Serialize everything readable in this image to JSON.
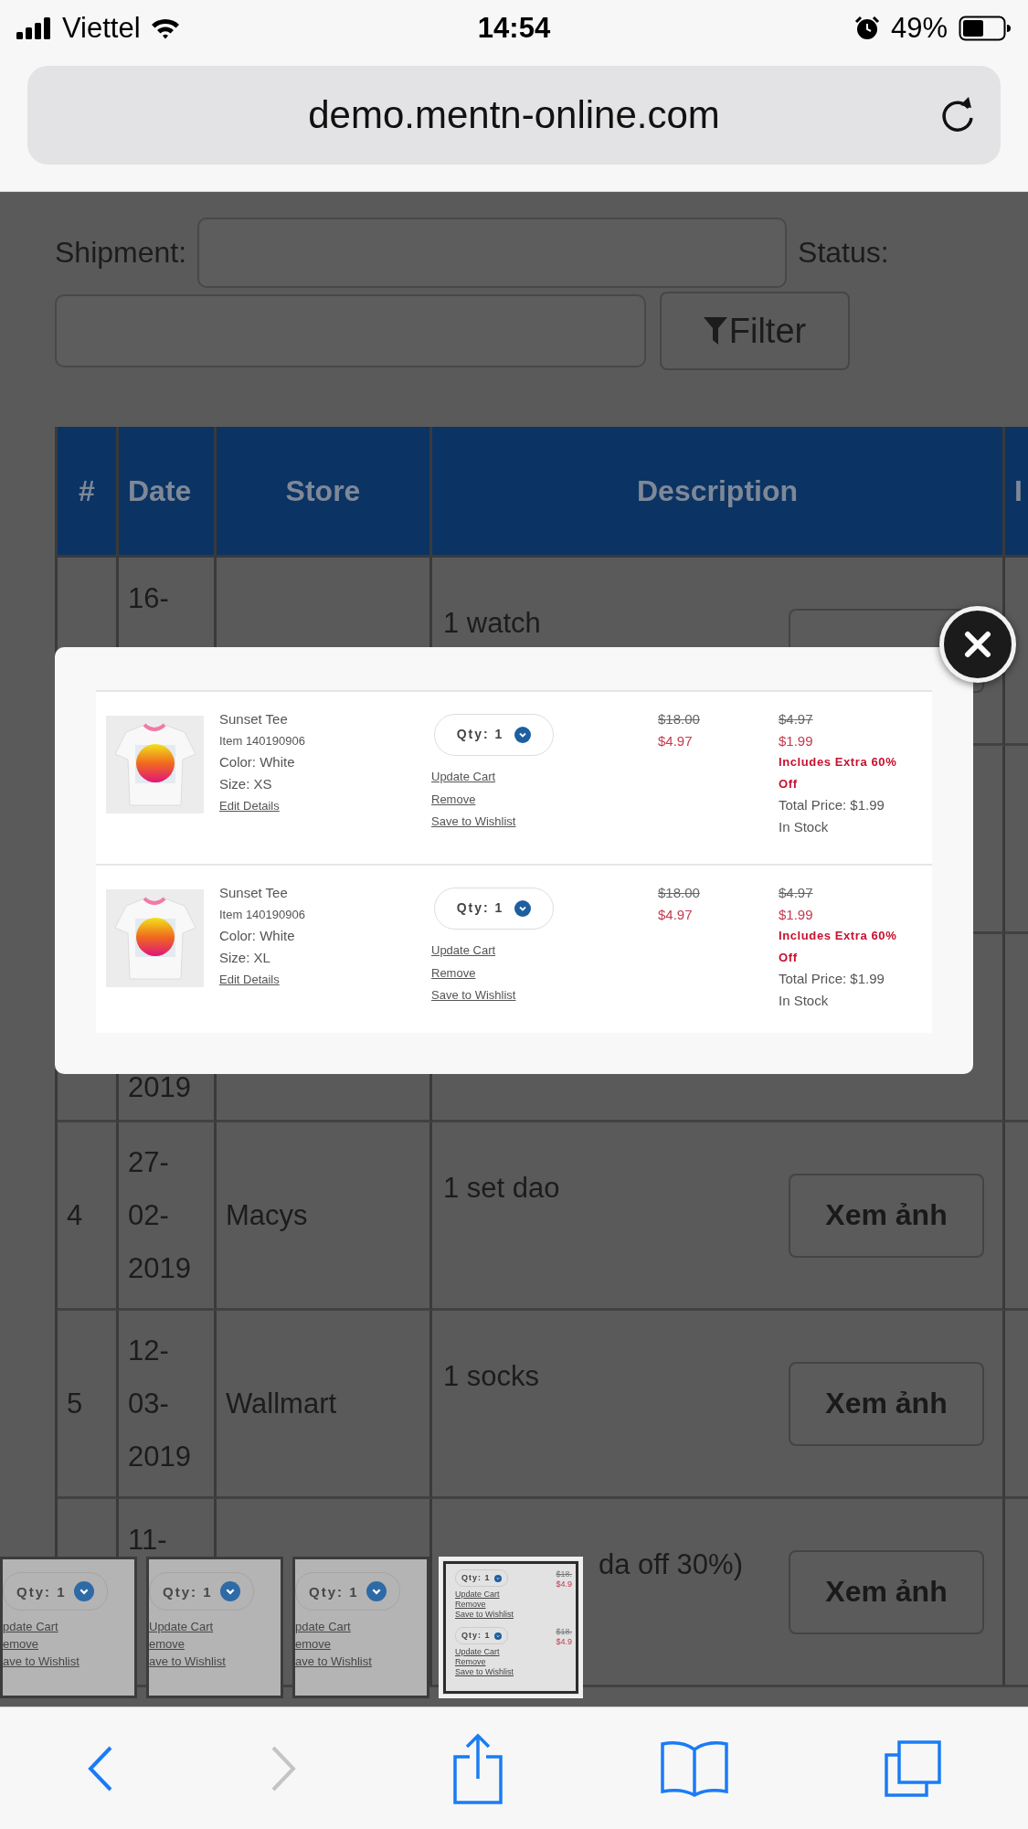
{
  "status_bar": {
    "carrier": "Viettel",
    "time": "14:54",
    "battery": "49%"
  },
  "address_bar": {
    "url": "demo.mentn-online.com"
  },
  "filters": {
    "shipment_label": "Shipment:",
    "status_label": "Status:",
    "filter_button": "Filter"
  },
  "table": {
    "columns": [
      "#",
      "Date",
      "Store",
      "Description",
      "I"
    ],
    "rows": [
      {
        "kind": "clipped",
        "date": "16-",
        "description": "1 watch",
        "action_covered": true
      },
      {
        "kind": "hidden"
      },
      {
        "kind": "tail",
        "date": "2019"
      },
      {
        "kind": "full",
        "number": "4",
        "date": "27-02-2019",
        "store": "Macys",
        "description": "1 set dao",
        "action": "Xem ảnh"
      },
      {
        "kind": "full",
        "number": "5",
        "date": "12-03-2019",
        "store": "Wallmart",
        "description": "1 socks",
        "action": "Xem ảnh"
      },
      {
        "kind": "overlaid",
        "date": "11-",
        "description": "da off 30%)",
        "action": "Xem ảnh"
      }
    ]
  },
  "modal": {
    "items": [
      {
        "name": "Sunset Tee",
        "item": "Item 140190906",
        "color_text": "Color: White",
        "size": "Size: XS",
        "edit": "Edit Details",
        "qty": "Qty: 1",
        "links": [
          "Update Cart",
          "Remove",
          "Save to Wishlist"
        ],
        "was_price": "$18.00",
        "price": "$4.97",
        "sale_was": "$4.97",
        "sale_price": "$1.99",
        "promo": "Includes Extra 60% Off",
        "total": "Total Price: $1.99",
        "stock": "In Stock"
      },
      {
        "name": "Sunset Tee",
        "item": "Item 140190906",
        "color_text": "Color: White",
        "size": "Size: XL",
        "edit": "Edit Details",
        "qty": "Qty: 1",
        "links": [
          "Update Cart",
          "Remove",
          "Save to Wishlist"
        ],
        "was_price": "$18.00",
        "price": "$4.97",
        "sale_was": "$4.97",
        "sale_price": "$1.99",
        "promo": "Includes Extra 60% Off",
        "total": "Total Price: $1.99",
        "stock": "In Stock"
      }
    ]
  },
  "thumbnails": [
    {
      "selected": false,
      "entries": [
        {
          "qty": "Qty: 1",
          "links": [
            "pdate Cart",
            "emove",
            "ave to Wishlist"
          ]
        }
      ]
    },
    {
      "selected": false,
      "entries": [
        {
          "qty": "Qty: 1",
          "links": [
            "Update Cart",
            "emove",
            "ave to Wishlist"
          ]
        }
      ]
    },
    {
      "selected": false,
      "entries": [
        {
          "qty": "Qty: 1",
          "links": [
            "pdate Cart",
            "emove",
            "ave to Wishlist"
          ]
        }
      ]
    },
    {
      "selected": true,
      "entries": [
        {
          "qty": "Qty: 1",
          "links": [
            "Update Cart",
            "Remove",
            "Save to Wishlist"
          ],
          "prices": [
            "$18.",
            "$4.9"
          ]
        },
        {
          "qty": "Qty: 1",
          "links": [
            "Update Cart",
            "Remove",
            "Save to Wishlist"
          ],
          "prices": [
            "$18.",
            "$4.9"
          ]
        }
      ]
    }
  ],
  "toolbar": {
    "back_disabled": false,
    "forward_disabled": true
  }
}
